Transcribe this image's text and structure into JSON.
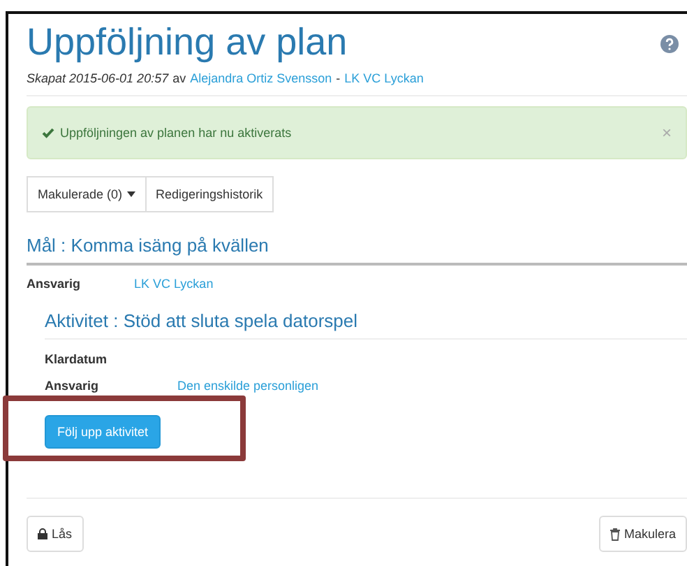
{
  "title": "Uppföljning av plan",
  "meta": {
    "created": "Skapat 2015-06-01 20:57",
    "by": "av",
    "author": "Alejandra Ortiz Svensson",
    "separator": "-",
    "unit": "LK VC Lyckan"
  },
  "alert": {
    "message": "Uppföljningen av planen har nu aktiverats",
    "close": "×"
  },
  "toolbar": [
    {
      "label": "Makulerade (0)",
      "kind": "dropdown"
    },
    {
      "label": "Redigeringshistorik",
      "kind": "plain"
    }
  ],
  "goal": {
    "heading": "Mål : Komma isäng på kvällen",
    "fields": [
      {
        "label": "Ansvarig",
        "value": "LK VC Lyckan"
      }
    ]
  },
  "activity": {
    "heading": "Aktivitet : Stöd att sluta spela datorspel",
    "fields": [
      {
        "label": "Klardatum"
      },
      {
        "label": "Ansvarig",
        "value": "Den enskilde personligen"
      }
    ],
    "button": "Följ upp aktivitet",
    "highlighted": true
  },
  "footer": {
    "lock": "Lås",
    "discard": "Makulera"
  }
}
